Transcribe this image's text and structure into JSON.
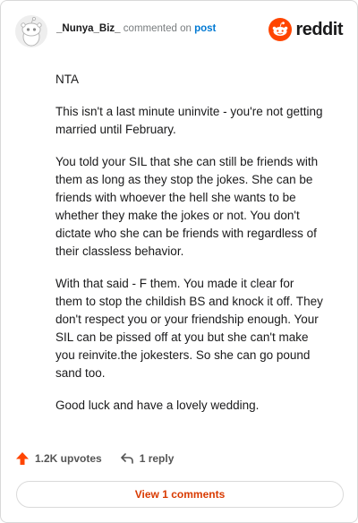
{
  "header": {
    "author": "_Nunya_Biz_",
    "commented_on": "commented on",
    "post_link": "post",
    "logo_text": "reddit"
  },
  "comment": {
    "paragraphs": [
      "NTA",
      "This isn't a last minute uninvite - you're not getting married until February.",
      "You told your SIL that she can still be friends with them as long as they stop the jokes. She can be friends with whoever the hell she wants to be whether they make the jokes or not. You don't dictate who she can be friends with regardless of their classless behavior.",
      "With that said - F them. You made it clear for them to stop the childish BS and knock it off. They don't respect you or your friendship enough. Your SIL can be pissed off at you but she can't make you reinvite.the jokesters. So she can go pound sand too.",
      "Good luck and have a lovely wedding."
    ]
  },
  "footer": {
    "upvotes": "1.2K upvotes",
    "replies": "1 reply",
    "view_comments": "View 1 comments"
  },
  "colors": {
    "brand": "#ff4500",
    "upvote": "#ff4500",
    "link": "#0079d3",
    "view_button_text": "#d93a00"
  },
  "icons": {
    "avatar": "snoo-avatar-icon",
    "logo": "reddit-snoo-logo-icon",
    "upvote": "upvote-arrow-icon",
    "reply": "reply-arrow-icon"
  }
}
